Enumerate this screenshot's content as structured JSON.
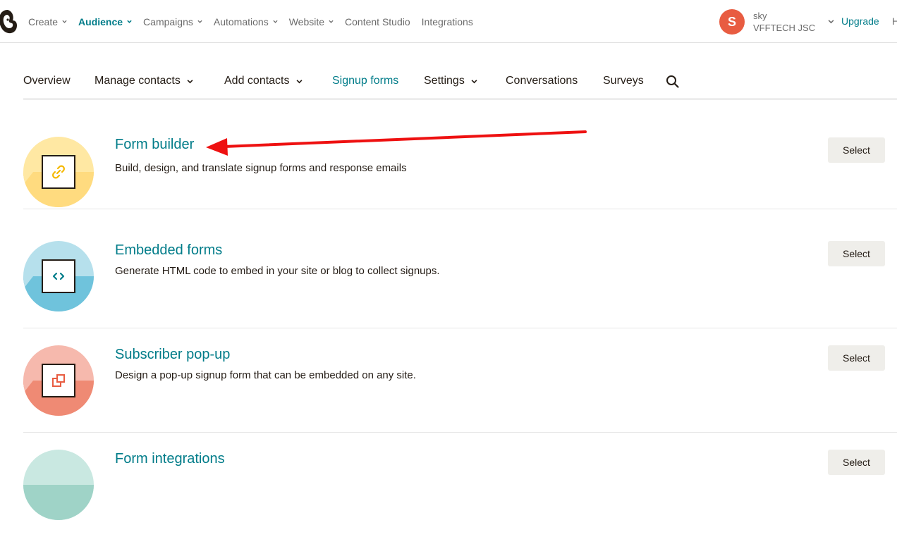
{
  "topnav": {
    "items": [
      {
        "label": "Create",
        "dropdown": true,
        "active": false
      },
      {
        "label": "Audience",
        "dropdown": true,
        "active": true
      },
      {
        "label": "Campaigns",
        "dropdown": true,
        "active": false
      },
      {
        "label": "Automations",
        "dropdown": true,
        "active": false
      },
      {
        "label": "Website",
        "dropdown": true,
        "active": false
      },
      {
        "label": "Content Studio",
        "dropdown": false,
        "active": false
      },
      {
        "label": "Integrations",
        "dropdown": false,
        "active": false
      }
    ],
    "account": {
      "avatar_letter": "S",
      "user": "sky",
      "org": "VFFTECH JSC"
    },
    "upgrade": "Upgrade",
    "help_partial": "H"
  },
  "subnav": {
    "tabs": [
      {
        "label": "Overview",
        "dropdown": false,
        "active": false
      },
      {
        "label": "Manage contacts",
        "dropdown": true,
        "active": false
      },
      {
        "label": "Add contacts",
        "dropdown": true,
        "active": false
      },
      {
        "label": "Signup forms",
        "dropdown": false,
        "active": true
      },
      {
        "label": "Settings",
        "dropdown": true,
        "active": false
      },
      {
        "label": "Conversations",
        "dropdown": false,
        "active": false
      },
      {
        "label": "Surveys",
        "dropdown": false,
        "active": false
      }
    ]
  },
  "forms": [
    {
      "title": "Form builder",
      "description": "Build, design, and translate signup forms and response emails",
      "button": "Select",
      "icon": "link-icon",
      "colors": {
        "light": "#ffe8a3",
        "dark": "#ffdb7f",
        "glyph": "#f5b800"
      }
    },
    {
      "title": "Embedded forms",
      "description": "Generate HTML code to embed in your site or blog to collect signups.",
      "button": "Select",
      "icon": "code-icon",
      "colors": {
        "light": "#b6e0ec",
        "dark": "#6fc3dc",
        "glyph": "#007c89"
      }
    },
    {
      "title": "Subscriber pop-up",
      "description": "Design a pop-up signup form that can be embedded on any site.",
      "button": "Select",
      "icon": "popup-icon",
      "colors": {
        "light": "#f6b9ad",
        "dark": "#ef8a74",
        "glyph": "#e85c41"
      }
    },
    {
      "title": "Form integrations",
      "description": "",
      "button": "Select",
      "icon": "integrations-icon",
      "colors": {
        "light": "#c9e8e1",
        "dark": "#9fd3c7",
        "glyph": "#007c89"
      }
    }
  ],
  "colors": {
    "accent": "#007c89",
    "annotation_arrow": "#ee1111"
  }
}
